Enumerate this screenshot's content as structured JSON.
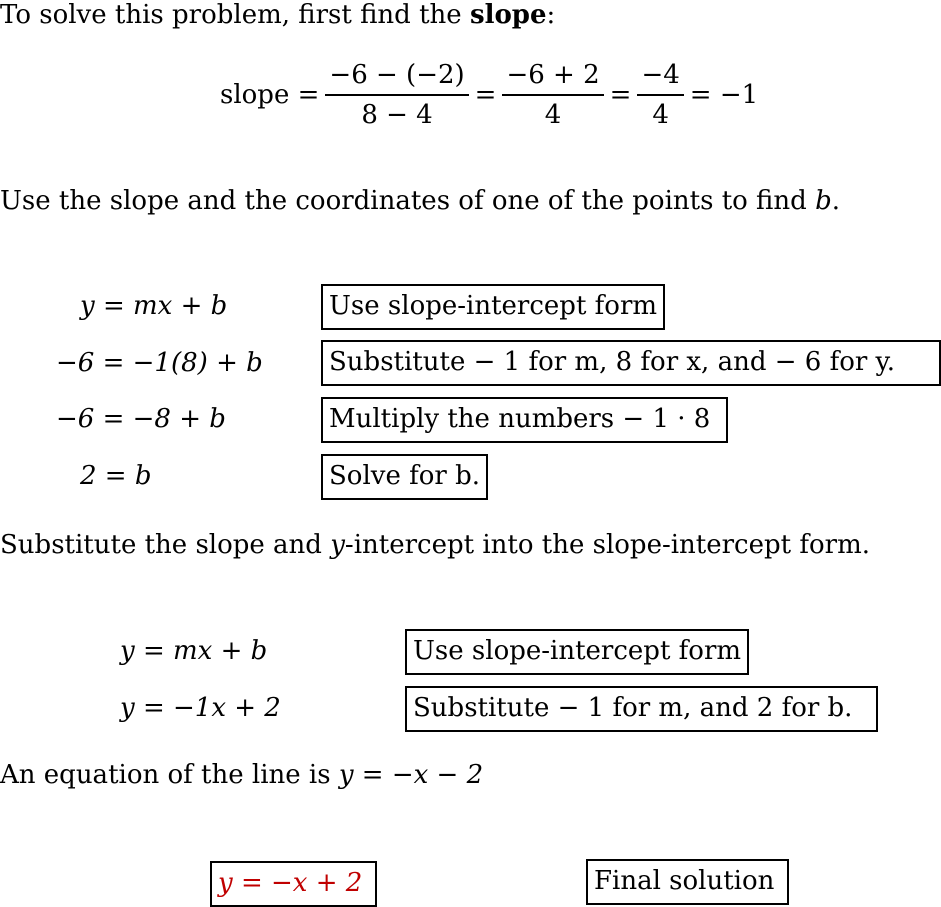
{
  "intro": {
    "text_before": "To solve this problem, first find the ",
    "bold": "slope",
    "text_after": ":"
  },
  "slope_eq": {
    "label": "slope =",
    "frac1_num": "−6 − (−2)",
    "frac1_den": "8 − 4",
    "eq1": "=",
    "frac2_num": "−6 + 2",
    "frac2_den": "4",
    "eq2": "=",
    "frac3_num": "−4",
    "frac3_den": "4",
    "result": "= −1"
  },
  "find_b_text": {
    "before": "Use the slope and the coordinates of one of the points to find ",
    "var": "b",
    "after": "."
  },
  "steps1": [
    {
      "equation": "y = mx + b",
      "note": "Use slope-intercept form"
    },
    {
      "equation": "−6 = −1(8) + b",
      "note": "Substitute  − 1 for m, 8 for x, and  − 6 for y."
    },
    {
      "equation": "−6 = −8 + b",
      "note": "Multiply the numbers  − 1 · 8"
    },
    {
      "equation": "2 = b",
      "note": "Solve for b."
    }
  ],
  "substitute_text": {
    "before": "Substitute the slope and ",
    "var": "y",
    "after": "-intercept into the slope-intercept form."
  },
  "steps2": [
    {
      "equation": "y = mx + b",
      "note": "Use slope-intercept form"
    },
    {
      "equation": "y = −1x + 2",
      "note": "Substitute  − 1 for m, and 2 for b."
    }
  ],
  "equation_text": {
    "before": "An equation of the line is ",
    "eq": "y = −x − 2"
  },
  "final": {
    "equation": "y = −x + 2",
    "label": "Final solution",
    "color": "#c00000"
  }
}
